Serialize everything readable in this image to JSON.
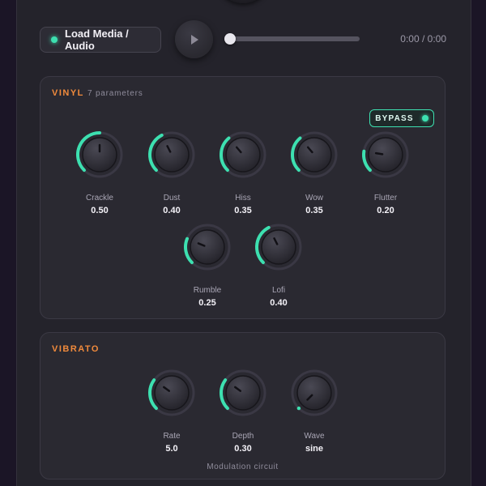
{
  "transport": {
    "load_label": "Load Media / Audio",
    "time": "0:00 / 0:00",
    "progress": 0.0
  },
  "colors": {
    "accent": "#3de0b0",
    "section_title": "#f08a3c",
    "background": "#24232b"
  },
  "icons": {
    "play": "play-icon",
    "led": "led-indicator"
  },
  "vinyl": {
    "title": "VINYL",
    "subtitle": "7 parameters",
    "bypass_label": "BYPASS",
    "knobs": [
      {
        "label": "Crackle",
        "value": "0.50",
        "level": 0.5
      },
      {
        "label": "Dust",
        "value": "0.40",
        "level": 0.4
      },
      {
        "label": "Hiss",
        "value": "0.35",
        "level": 0.35
      },
      {
        "label": "Wow",
        "value": "0.35",
        "level": 0.35
      },
      {
        "label": "Flutter",
        "value": "0.20",
        "level": 0.2
      },
      {
        "label": "Rumble",
        "value": "0.25",
        "level": 0.25
      },
      {
        "label": "Lofi",
        "value": "0.40",
        "level": 0.4
      }
    ]
  },
  "vibrato": {
    "title": "VIBRATO",
    "footer": "Modulation circuit",
    "knobs": [
      {
        "label": "Rate",
        "value": "5.0",
        "level": 0.3
      },
      {
        "label": "Depth",
        "value": "0.30",
        "level": 0.3
      },
      {
        "label": "Wave",
        "value": "sine",
        "level": 0.0
      }
    ]
  }
}
